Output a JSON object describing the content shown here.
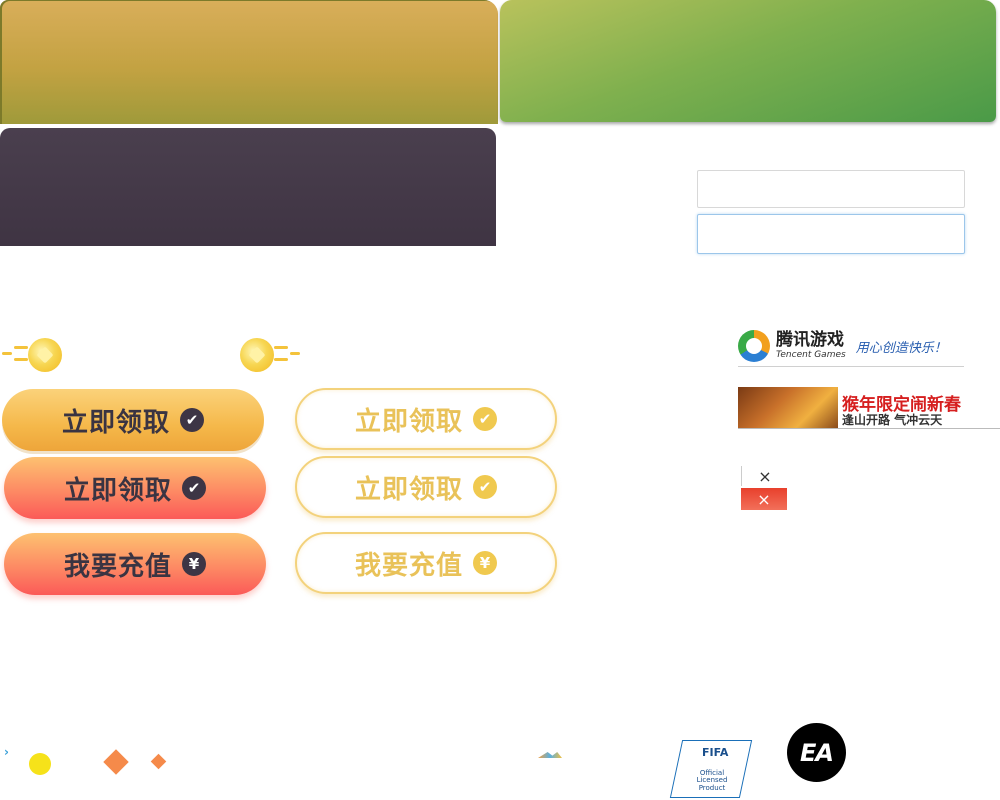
{
  "inputs": {
    "field_1": {
      "value": "",
      "placeholder": ""
    },
    "field_2": {
      "value": "",
      "placeholder": ""
    }
  },
  "buttons": {
    "claim_gold": {
      "label": "立即领取",
      "icon": "check-circle-icon"
    },
    "claim_gold_outline": {
      "label": "立即领取",
      "icon": "check-circle-icon"
    },
    "claim_red": {
      "label": "立即领取",
      "icon": "check-circle-icon"
    },
    "claim_red_outline": {
      "label": "立即领取",
      "icon": "check-circle-icon"
    },
    "recharge_red": {
      "label": "我要充值",
      "icon": "yen-circle-icon"
    },
    "recharge_outline": {
      "label": "我要充值",
      "icon": "yen-circle-icon"
    }
  },
  "icons": {
    "check": "✔",
    "yen": "¥",
    "close": "×"
  },
  "logos": {
    "tencent": {
      "cn": "腾讯游戏",
      "en": "Tencent Games",
      "slogan": "用心创造快乐！"
    },
    "promo": {
      "line1": "猴年限定闹新春",
      "line2": "逢山开路 气冲云天"
    },
    "fifa": {
      "title": "FIFA",
      "sub": "Official Licensed Product"
    },
    "ea": {
      "text": "EA"
    }
  },
  "colors": {
    "gold_panel": "#c3a242",
    "green_panel": "#7fb04e",
    "purple_panel": "#453a49",
    "button_gold": "#f5b84a",
    "button_red": "#fb5a58",
    "outline_text": "#e9c259"
  }
}
